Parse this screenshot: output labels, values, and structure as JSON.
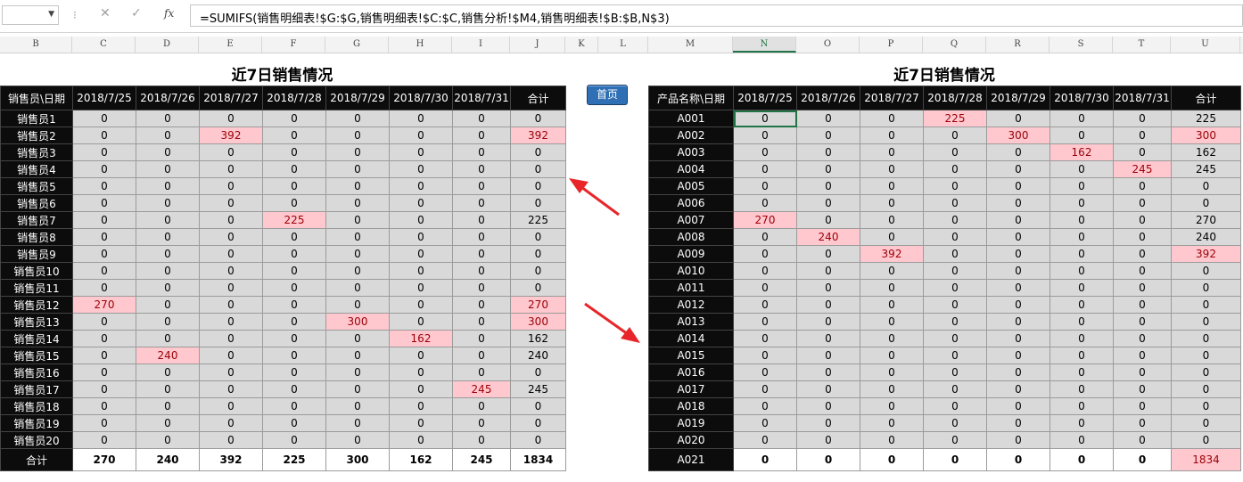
{
  "formula_bar": {
    "name_box": "",
    "cancel_icon": "✕",
    "enter_icon": "✓",
    "fx_label": "fx",
    "formula": "=SUMIFS(销售明细表!$G:$G,销售明细表!$C:$C,销售分析!$M4,销售明细表!$B:$B,N$3)"
  },
  "columns": [
    "B",
    "C",
    "D",
    "E",
    "F",
    "G",
    "H",
    "I",
    "J",
    "K",
    "L",
    "M",
    "N",
    "O",
    "P",
    "Q",
    "R",
    "S",
    "T",
    "U"
  ],
  "selected_column": "N",
  "home_button": "首页",
  "left_table": {
    "title": "近7日销售情况",
    "corner": "销售员\\日期",
    "headers": [
      "2018/7/25",
      "2018/7/26",
      "2018/7/27",
      "2018/7/28",
      "2018/7/29",
      "2018/7/30",
      "2018/7/31",
      "合计"
    ],
    "rows": [
      {
        "label": "销售员1",
        "values": [
          "0",
          "0",
          "0",
          "0",
          "0",
          "0",
          "0",
          "0"
        ]
      },
      {
        "label": "销售员2",
        "values": [
          "0",
          "0",
          "392",
          "0",
          "0",
          "0",
          "0",
          "392"
        ],
        "pink": [
          2,
          7
        ]
      },
      {
        "label": "销售员3",
        "values": [
          "0",
          "0",
          "0",
          "0",
          "0",
          "0",
          "0",
          "0"
        ]
      },
      {
        "label": "销售员4",
        "values": [
          "0",
          "0",
          "0",
          "0",
          "0",
          "0",
          "0",
          "0"
        ]
      },
      {
        "label": "销售员5",
        "values": [
          "0",
          "0",
          "0",
          "0",
          "0",
          "0",
          "0",
          "0"
        ]
      },
      {
        "label": "销售员6",
        "values": [
          "0",
          "0",
          "0",
          "0",
          "0",
          "0",
          "0",
          "0"
        ]
      },
      {
        "label": "销售员7",
        "values": [
          "0",
          "0",
          "0",
          "225",
          "0",
          "0",
          "0",
          "225"
        ],
        "pink": [
          3
        ]
      },
      {
        "label": "销售员8",
        "values": [
          "0",
          "0",
          "0",
          "0",
          "0",
          "0",
          "0",
          "0"
        ]
      },
      {
        "label": "销售员9",
        "values": [
          "0",
          "0",
          "0",
          "0",
          "0",
          "0",
          "0",
          "0"
        ]
      },
      {
        "label": "销售员10",
        "values": [
          "0",
          "0",
          "0",
          "0",
          "0",
          "0",
          "0",
          "0"
        ]
      },
      {
        "label": "销售员11",
        "values": [
          "0",
          "0",
          "0",
          "0",
          "0",
          "0",
          "0",
          "0"
        ]
      },
      {
        "label": "销售员12",
        "values": [
          "270",
          "0",
          "0",
          "0",
          "0",
          "0",
          "0",
          "270"
        ],
        "pink": [
          0,
          7
        ]
      },
      {
        "label": "销售员13",
        "values": [
          "0",
          "0",
          "0",
          "0",
          "300",
          "0",
          "0",
          "300"
        ],
        "pink": [
          4,
          7
        ]
      },
      {
        "label": "销售员14",
        "values": [
          "0",
          "0",
          "0",
          "0",
          "0",
          "162",
          "0",
          "162"
        ],
        "pink": [
          5
        ]
      },
      {
        "label": "销售员15",
        "values": [
          "0",
          "240",
          "0",
          "0",
          "0",
          "0",
          "0",
          "240"
        ],
        "pink": [
          1
        ]
      },
      {
        "label": "销售员16",
        "values": [
          "0",
          "0",
          "0",
          "0",
          "0",
          "0",
          "0",
          "0"
        ]
      },
      {
        "label": "销售员17",
        "values": [
          "0",
          "0",
          "0",
          "0",
          "0",
          "0",
          "245",
          "245"
        ],
        "pink": [
          6
        ]
      },
      {
        "label": "销售员18",
        "values": [
          "0",
          "0",
          "0",
          "0",
          "0",
          "0",
          "0",
          "0"
        ]
      },
      {
        "label": "销售员19",
        "values": [
          "0",
          "0",
          "0",
          "0",
          "0",
          "0",
          "0",
          "0"
        ]
      },
      {
        "label": "销售员20",
        "values": [
          "0",
          "0",
          "0",
          "0",
          "0",
          "0",
          "0",
          "0"
        ]
      }
    ],
    "total": {
      "label": "合计",
      "values": [
        "270",
        "240",
        "392",
        "225",
        "300",
        "162",
        "245",
        "1834"
      ]
    }
  },
  "right_table": {
    "title": "近7日销售情况",
    "corner": "产品名称\\日期",
    "headers": [
      "2018/7/25",
      "2018/7/26",
      "2018/7/27",
      "2018/7/28",
      "2018/7/29",
      "2018/7/30",
      "2018/7/31",
      "合计"
    ],
    "rows": [
      {
        "label": "A001",
        "values": [
          "0",
          "0",
          "0",
          "225",
          "0",
          "0",
          "0",
          "225"
        ],
        "pink": [
          3
        ],
        "selected": 0
      },
      {
        "label": "A002",
        "values": [
          "0",
          "0",
          "0",
          "0",
          "300",
          "0",
          "0",
          "300"
        ],
        "pink": [
          4,
          7
        ]
      },
      {
        "label": "A003",
        "values": [
          "0",
          "0",
          "0",
          "0",
          "0",
          "162",
          "0",
          "162"
        ],
        "pink": [
          5
        ]
      },
      {
        "label": "A004",
        "values": [
          "0",
          "0",
          "0",
          "0",
          "0",
          "0",
          "245",
          "245"
        ],
        "pink": [
          6
        ]
      },
      {
        "label": "A005",
        "values": [
          "0",
          "0",
          "0",
          "0",
          "0",
          "0",
          "0",
          "0"
        ]
      },
      {
        "label": "A006",
        "values": [
          "0",
          "0",
          "0",
          "0",
          "0",
          "0",
          "0",
          "0"
        ]
      },
      {
        "label": "A007",
        "values": [
          "270",
          "0",
          "0",
          "0",
          "0",
          "0",
          "0",
          "270"
        ],
        "pink": [
          0
        ]
      },
      {
        "label": "A008",
        "values": [
          "0",
          "240",
          "0",
          "0",
          "0",
          "0",
          "0",
          "240"
        ],
        "pink": [
          1
        ]
      },
      {
        "label": "A009",
        "values": [
          "0",
          "0",
          "392",
          "0",
          "0",
          "0",
          "0",
          "392"
        ],
        "pink": [
          2,
          7
        ]
      },
      {
        "label": "A010",
        "values": [
          "0",
          "0",
          "0",
          "0",
          "0",
          "0",
          "0",
          "0"
        ]
      },
      {
        "label": "A011",
        "values": [
          "0",
          "0",
          "0",
          "0",
          "0",
          "0",
          "0",
          "0"
        ]
      },
      {
        "label": "A012",
        "values": [
          "0",
          "0",
          "0",
          "0",
          "0",
          "0",
          "0",
          "0"
        ]
      },
      {
        "label": "A013",
        "values": [
          "0",
          "0",
          "0",
          "0",
          "0",
          "0",
          "0",
          "0"
        ]
      },
      {
        "label": "A014",
        "values": [
          "0",
          "0",
          "0",
          "0",
          "0",
          "0",
          "0",
          "0"
        ]
      },
      {
        "label": "A015",
        "values": [
          "0",
          "0",
          "0",
          "0",
          "0",
          "0",
          "0",
          "0"
        ]
      },
      {
        "label": "A016",
        "values": [
          "0",
          "0",
          "0",
          "0",
          "0",
          "0",
          "0",
          "0"
        ]
      },
      {
        "label": "A017",
        "values": [
          "0",
          "0",
          "0",
          "0",
          "0",
          "0",
          "0",
          "0"
        ]
      },
      {
        "label": "A018",
        "values": [
          "0",
          "0",
          "0",
          "0",
          "0",
          "0",
          "0",
          "0"
        ]
      },
      {
        "label": "A019",
        "values": [
          "0",
          "0",
          "0",
          "0",
          "0",
          "0",
          "0",
          "0"
        ]
      },
      {
        "label": "A020",
        "values": [
          "0",
          "0",
          "0",
          "0",
          "0",
          "0",
          "0",
          "0"
        ]
      }
    ],
    "total": {
      "label": "A021",
      "values": [
        "0",
        "0",
        "0",
        "0",
        "0",
        "0",
        "0",
        "1834"
      ],
      "pink": [
        7
      ]
    }
  },
  "annotation_color": "#e8262a"
}
